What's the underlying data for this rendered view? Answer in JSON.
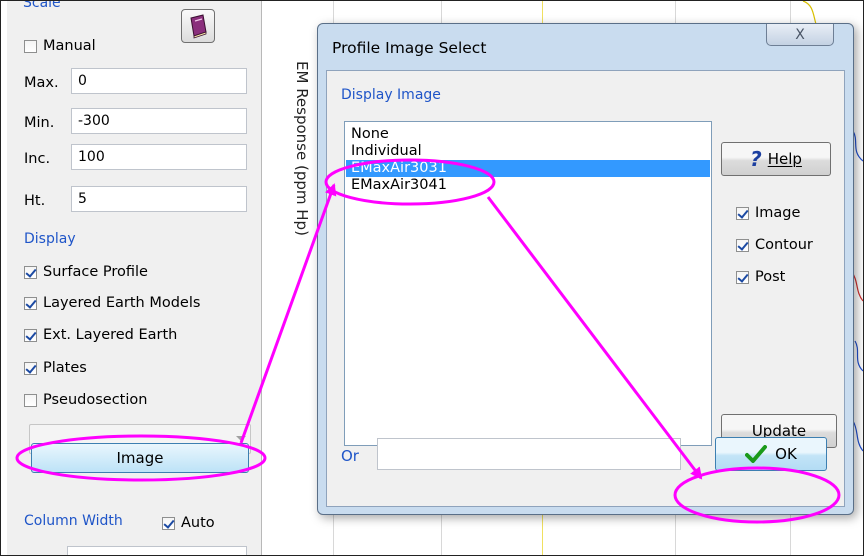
{
  "left_panel": {
    "scale_title": "Scale",
    "manual_label": "Manual",
    "fields": [
      {
        "label": "Max.",
        "value": "0"
      },
      {
        "label": "Min.",
        "value": "-300"
      },
      {
        "label": "Inc.",
        "value": "100"
      },
      {
        "label": "Ht.",
        "value": "5"
      }
    ],
    "display_title": "Display",
    "display_options": [
      {
        "label": "Surface Profile",
        "checked": true
      },
      {
        "label": "Layered Earth Models",
        "checked": true
      },
      {
        "label": "Ext. Layered Earth",
        "checked": true
      },
      {
        "label": "Plates",
        "checked": true
      },
      {
        "label": "Pseudosection",
        "checked": false
      }
    ],
    "image_button_label": "Image",
    "column_width_title": "Column Width",
    "auto_label": "Auto",
    "book_icon": "book-icon"
  },
  "plot": {
    "axis_label": "EM Response (ppm Hp)"
  },
  "dialog": {
    "title": "Profile Image Select",
    "close_label": "X",
    "display_image_title": "Display Image",
    "list_items": [
      "None",
      "Individual",
      "EMaxAir3031",
      "EMaxAir3041"
    ],
    "selected_index": 2,
    "help_label": "Help",
    "help_icon": "question-mark-icon",
    "options": [
      {
        "label": "Image",
        "checked": true
      },
      {
        "label": "Contour",
        "checked": true
      },
      {
        "label": "Post",
        "checked": true
      }
    ],
    "update_label": "Update",
    "or_label": "Or",
    "ok_label": "OK",
    "ok_icon": "checkmark-icon"
  },
  "colors": {
    "annotation": "#ff00ff",
    "selection": "#3399ff",
    "section_title": "#1f55c8"
  }
}
